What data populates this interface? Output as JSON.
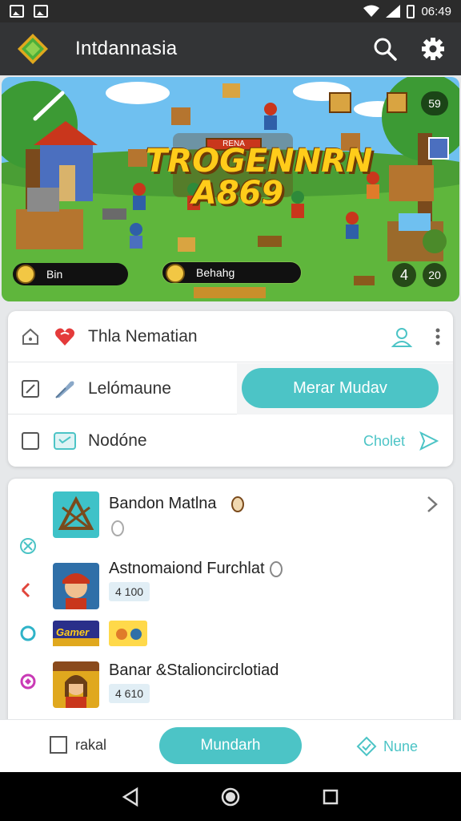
{
  "status_bar": {
    "time": "06:49"
  },
  "app_bar": {
    "title": "Intdannasia",
    "icons": [
      "app-logo-icon",
      "search-icon",
      "gear-icon"
    ]
  },
  "banner": {
    "title_line1": "TROGENNRN",
    "title_line2": "A869",
    "sub_label": "RENA",
    "counter": "59",
    "pill1": "Bin",
    "pill2": "Behahg",
    "round1": "4",
    "round2": "20"
  },
  "form": {
    "row1_label": "Thla Nematian",
    "row2_label": "Lelómaune",
    "row2_button": "Merar Mudav",
    "row3_label": "Nodóne",
    "row3_link": "Cholet"
  },
  "list": {
    "items": [
      {
        "title": "Bandon Matlna",
        "badge": ""
      },
      {
        "title": "Astnomaiond Furchlat",
        "badge": "4 100"
      },
      {
        "title": "",
        "badge": ""
      },
      {
        "title": "Banar &Stalioncirclotiad",
        "badge": "4 610"
      }
    ],
    "thumb3_text": "Gamer"
  },
  "bottom_bar": {
    "left_label": "rakal",
    "center_button": "Mundarh",
    "right_label": "Nune"
  },
  "colors": {
    "accent": "#4cc4c6",
    "app_bar": "#333436",
    "status_bar": "#2b2b2b"
  }
}
